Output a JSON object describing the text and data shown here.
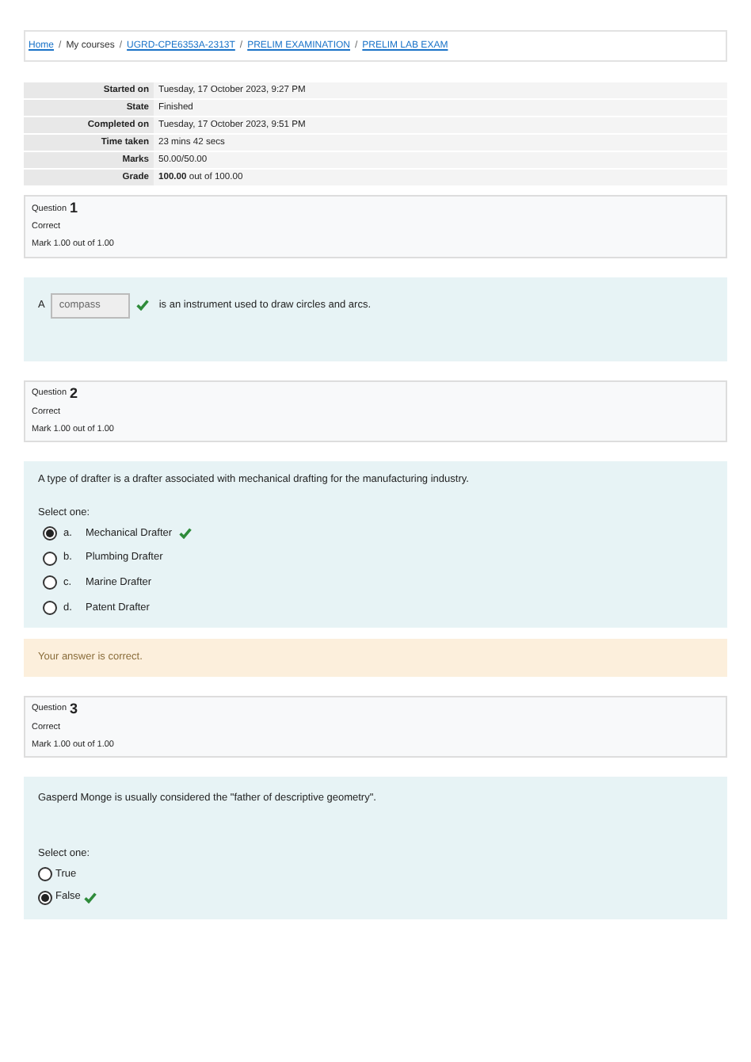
{
  "breadcrumb": [
    {
      "label": "Home",
      "link": true
    },
    {
      "label": "My courses",
      "link": false
    },
    {
      "label": "UGRD-CPE6353A-2313T",
      "link": true
    },
    {
      "label": "PRELIM EXAMINATION",
      "link": true
    },
    {
      "label": "PRELIM LAB EXAM",
      "link": true
    }
  ],
  "breadcrumb_separator": "/",
  "summary": [
    {
      "label": "Started on",
      "value": "Tuesday, 17 October 2023, 9:27 PM"
    },
    {
      "label": "State",
      "value": "Finished"
    },
    {
      "label": "Completed on",
      "value": "Tuesday, 17 October 2023, 9:51 PM"
    },
    {
      "label": "Time taken",
      "value": "23 mins 42 secs"
    },
    {
      "label": "Marks",
      "value": "50.00/50.00"
    },
    {
      "label": "Grade",
      "value": "**100.00** out of 100.00"
    }
  ],
  "questions": [
    {
      "kind": "gap",
      "label": "Question",
      "number": "1",
      "status": "Correct",
      "mark": "Mark 1.00 out of 1.00",
      "before": "A",
      "answer": "compass",
      "correct": true,
      "after": "is an instrument used to draw circles and arcs."
    },
    {
      "kind": "lettered",
      "label": "Question",
      "number": "2",
      "status": "Correct",
      "mark": "Mark 1.00 out of 1.00",
      "text": "A type of drafter is a drafter associated with mechanical drafting for the manufacturing industry.",
      "prompt": "Select one:",
      "options": [
        {
          "letter": "a.",
          "label": "Mechanical Drafter",
          "selected": true,
          "correct": true
        },
        {
          "letter": "b.",
          "label": "Plumbing Drafter",
          "selected": false,
          "correct": false
        },
        {
          "letter": "c.",
          "label": "Marine Drafter",
          "selected": false,
          "correct": false
        },
        {
          "letter": "d.",
          "label": "Patent Drafter",
          "selected": false,
          "correct": false
        }
      ],
      "feedback": "Your answer is correct."
    },
    {
      "kind": "truefalse",
      "label": "Question",
      "number": "3",
      "status": "Correct",
      "mark": "Mark 1.00 out of 1.00",
      "text": "Gasperd Monge is usually considered the \"father of descriptive geometry\".",
      "prompt": "Select one:",
      "options": [
        {
          "label": "True",
          "selected": false,
          "correct": false
        },
        {
          "label": "False",
          "selected": true,
          "correct": true
        }
      ]
    }
  ]
}
